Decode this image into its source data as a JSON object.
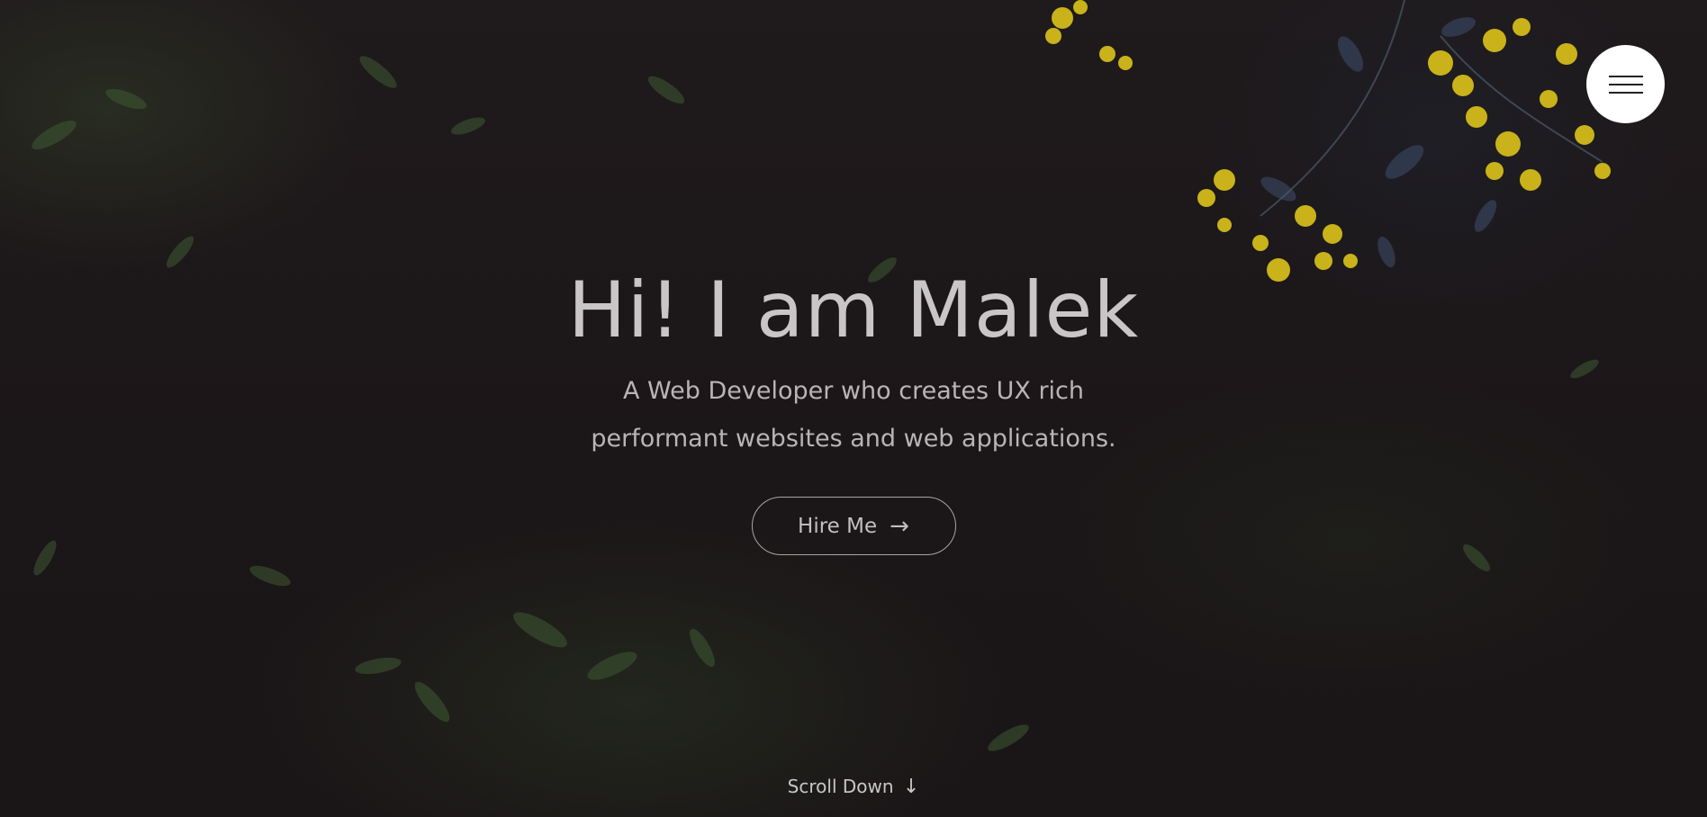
{
  "hero": {
    "title": "Hi! I am Malek",
    "subtitle": "A Web Developer who creates UX rich performant websites and web applications.",
    "cta_label": "Hire Me",
    "cta_icon": "→",
    "scroll_label": "Scroll Down",
    "scroll_icon": "↓"
  },
  "menu": {
    "icon": "hamburger-icon"
  },
  "colors": {
    "background": "#1b1618",
    "text": "#c9c6c7",
    "menu_button": "#ffffff",
    "flower_accent": "#c9b21a"
  }
}
